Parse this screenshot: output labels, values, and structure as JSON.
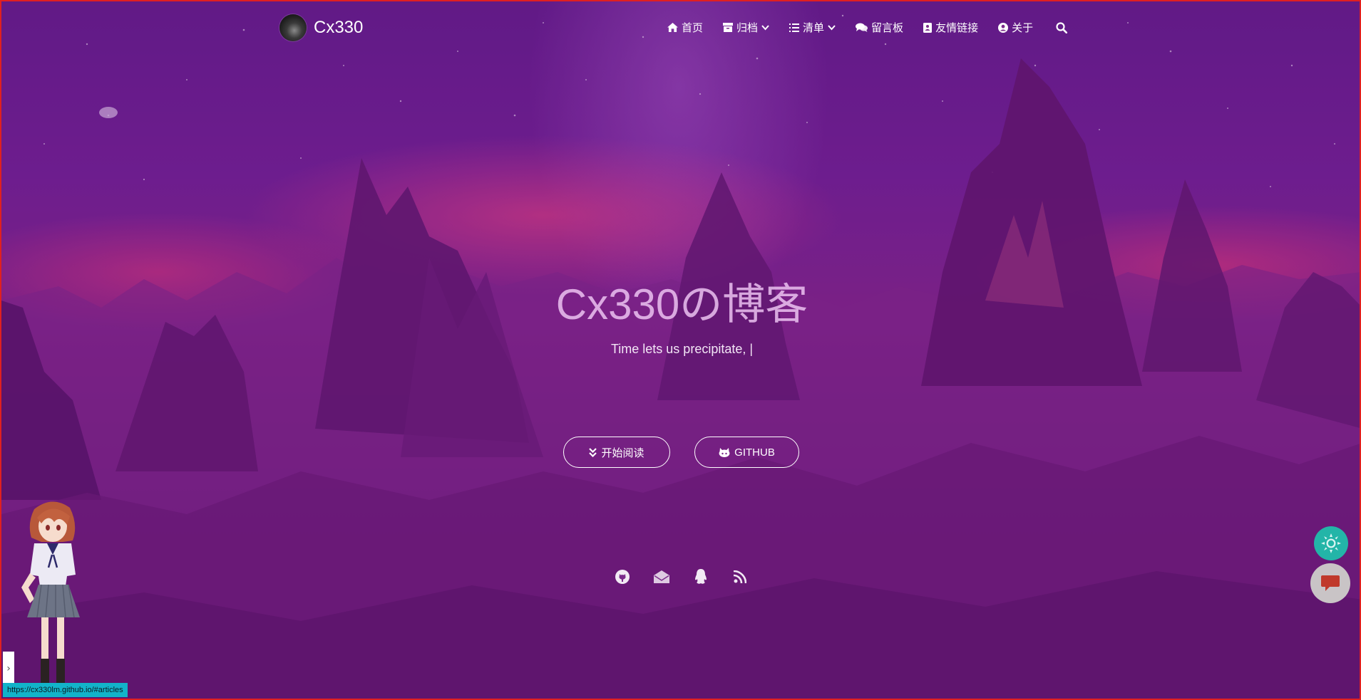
{
  "nav": {
    "logo_text": "Cx330",
    "items": [
      {
        "label": "首页",
        "icon": "home-icon",
        "dropdown": false
      },
      {
        "label": "归档",
        "icon": "archive-icon",
        "dropdown": true
      },
      {
        "label": "清单",
        "icon": "list-icon",
        "dropdown": true
      },
      {
        "label": "留言板",
        "icon": "comments-icon",
        "dropdown": false
      },
      {
        "label": "友情链接",
        "icon": "address-book-icon",
        "dropdown": false
      },
      {
        "label": "关于",
        "icon": "user-circle-icon",
        "dropdown": false
      }
    ]
  },
  "hero": {
    "title": "Cx330の博客",
    "subtitle": "Time lets us precipitate, |",
    "read_button": "开始阅读",
    "github_button": "GITHUB"
  },
  "socials": [
    "github-icon",
    "envelope-icon",
    "qq-icon",
    "rss-icon"
  ],
  "widgets": {
    "side_toggle": "›",
    "status_url": "https://cx330lm.github.io/#articles"
  },
  "colors": {
    "theme_button": "#23b5a8",
    "chat_button": "#c9c4c6",
    "chat_icon": "#c0392b",
    "status_bar": "#12b3c9",
    "window_border": "#e02020"
  }
}
